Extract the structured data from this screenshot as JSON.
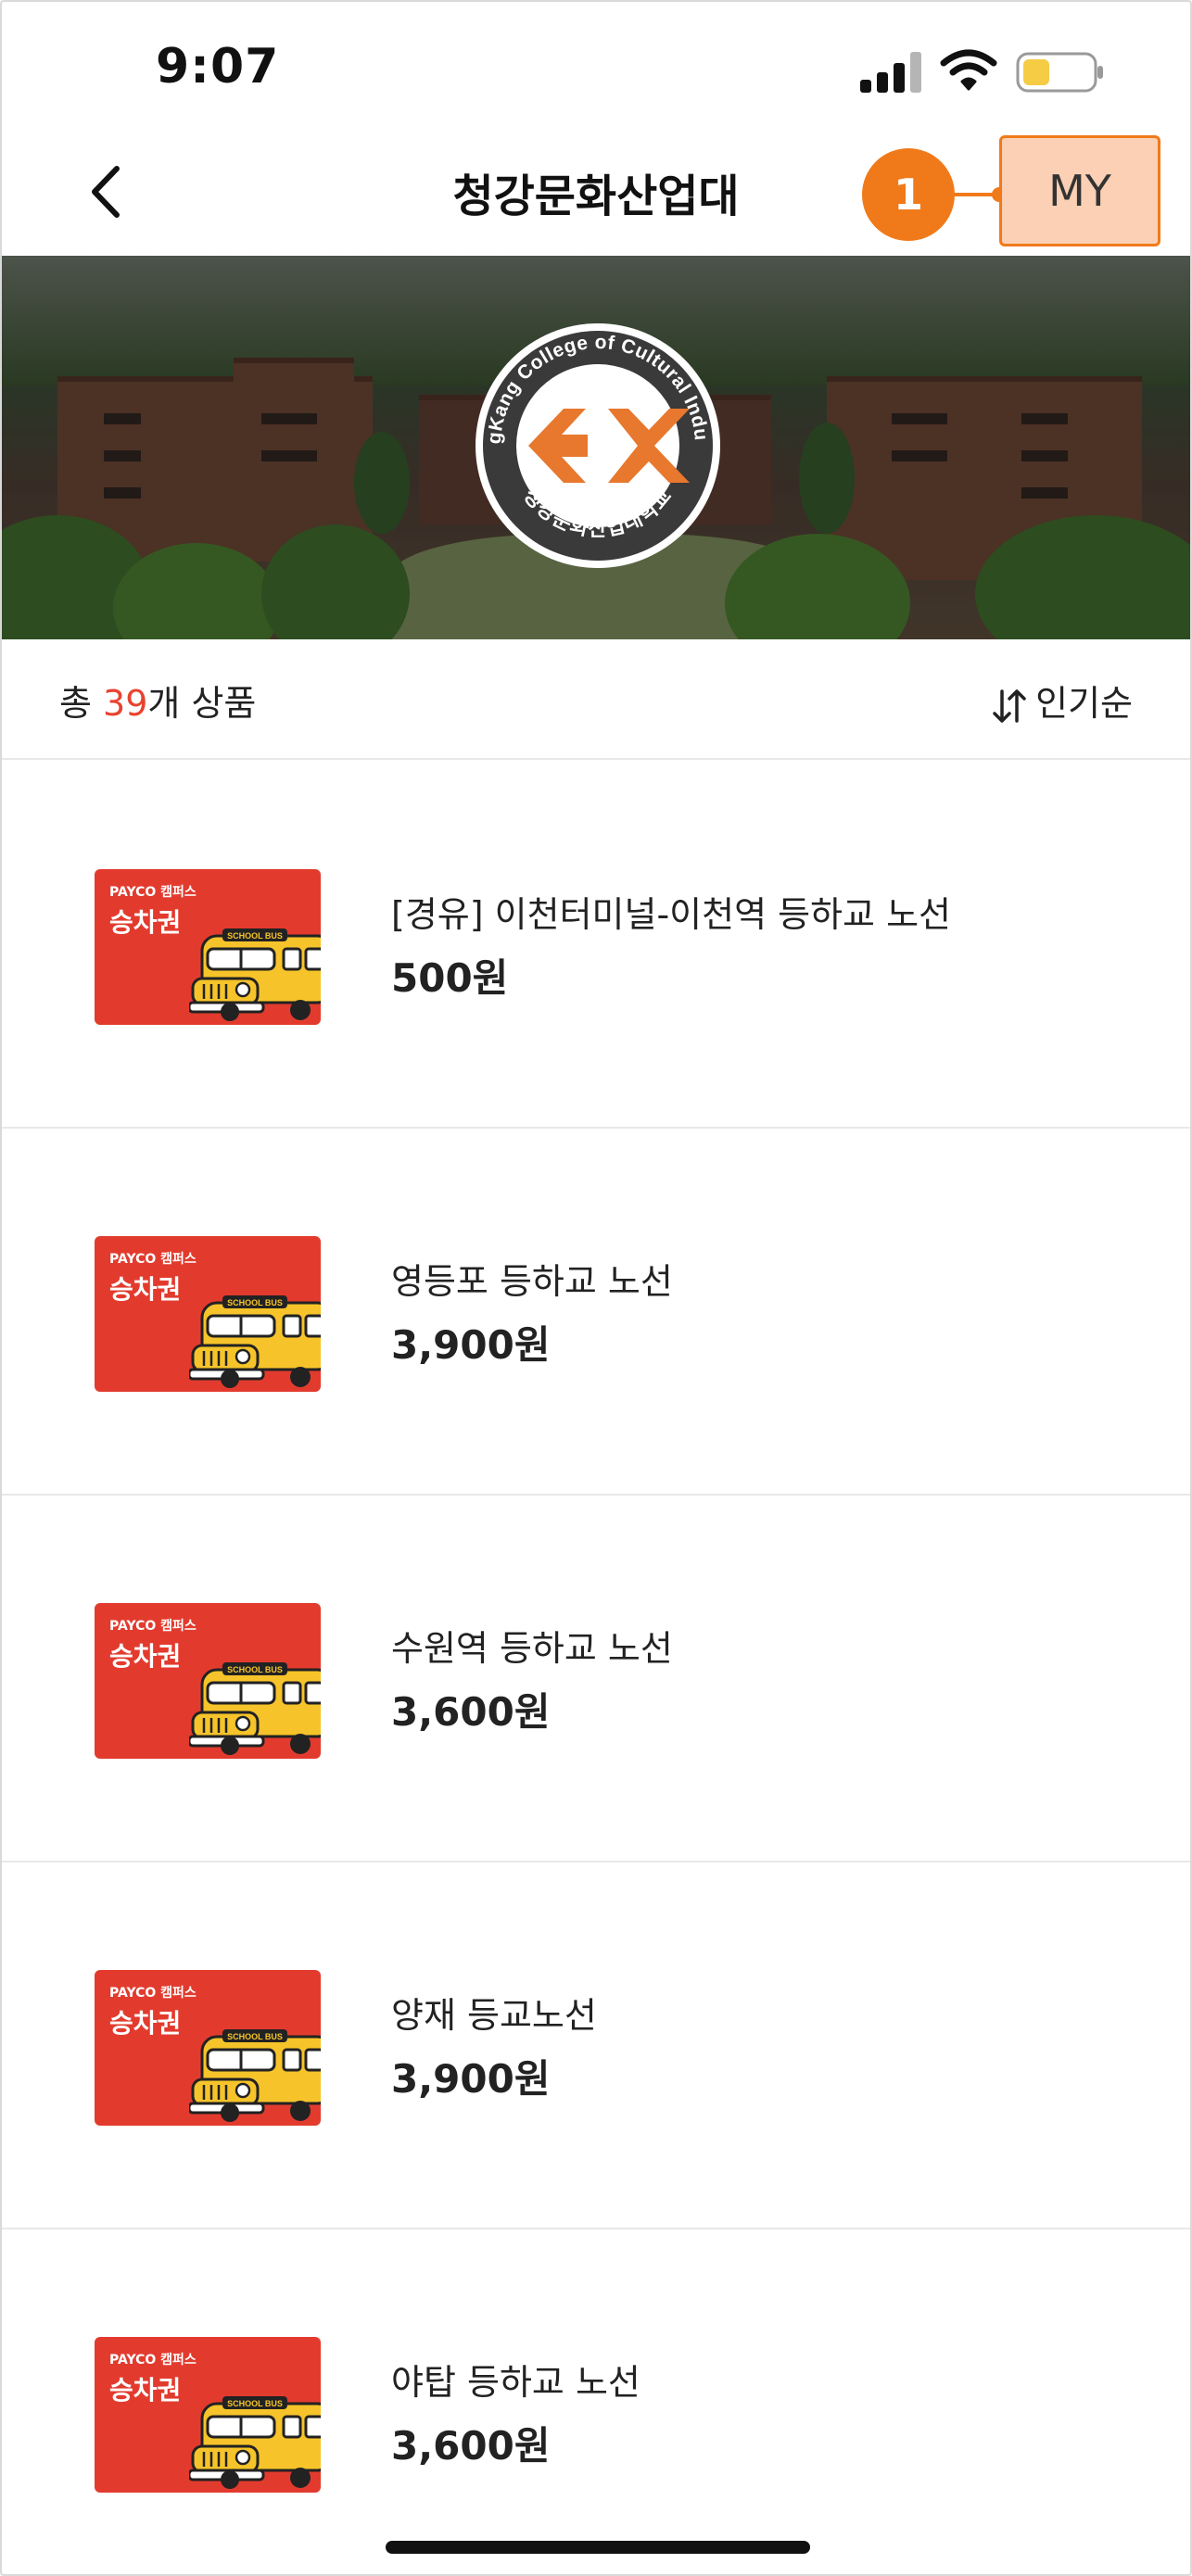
{
  "status_bar": {
    "time": "9:07",
    "signal_icon": "cellular-signal-icon",
    "wifi_icon": "wifi-icon",
    "battery_icon": "battery-icon",
    "battery_color": "#f5cc44"
  },
  "nav": {
    "title": "청강문화산업대",
    "back_icon": "chevron-left-icon",
    "step_number": "1",
    "my_label": "MY",
    "accent": "#f07a1a"
  },
  "banner": {
    "emblem_ring_text": "ChungKang College of Cultural Industries",
    "emblem_korean": "청강문화산업대학교",
    "emblem_logo_color": "#e8782e"
  },
  "list": {
    "count_prefix": "총 ",
    "count": "39",
    "count_suffix": "개 상품",
    "sort_icon": "sort-arrows-icon",
    "sort_label": "인기순"
  },
  "products": [
    {
      "thumb_brand": "PAYCO 캠퍼스",
      "thumb_label": "승차권",
      "thumb_bus_sign": "SCHOOL BUS",
      "title": "[경유] 이천터미널-이천역 등하교 노선",
      "price": "500원"
    },
    {
      "thumb_brand": "PAYCO 캠퍼스",
      "thumb_label": "승차권",
      "thumb_bus_sign": "SCHOOL BUS",
      "title": "영등포 등하교 노선",
      "price": "3,900원"
    },
    {
      "thumb_brand": "PAYCO 캠퍼스",
      "thumb_label": "승차권",
      "thumb_bus_sign": "SCHOOL BUS",
      "title": "수원역 등하교 노선",
      "price": "3,600원"
    },
    {
      "thumb_brand": "PAYCO 캠퍼스",
      "thumb_label": "승차권",
      "thumb_bus_sign": "SCHOOL BUS",
      "title": "양재 등교노선",
      "price": "3,900원"
    },
    {
      "thumb_brand": "PAYCO 캠퍼스",
      "thumb_label": "승차권",
      "thumb_bus_sign": "SCHOOL BUS",
      "title": "야탑 등하교 노선",
      "price": "3,600원"
    }
  ]
}
